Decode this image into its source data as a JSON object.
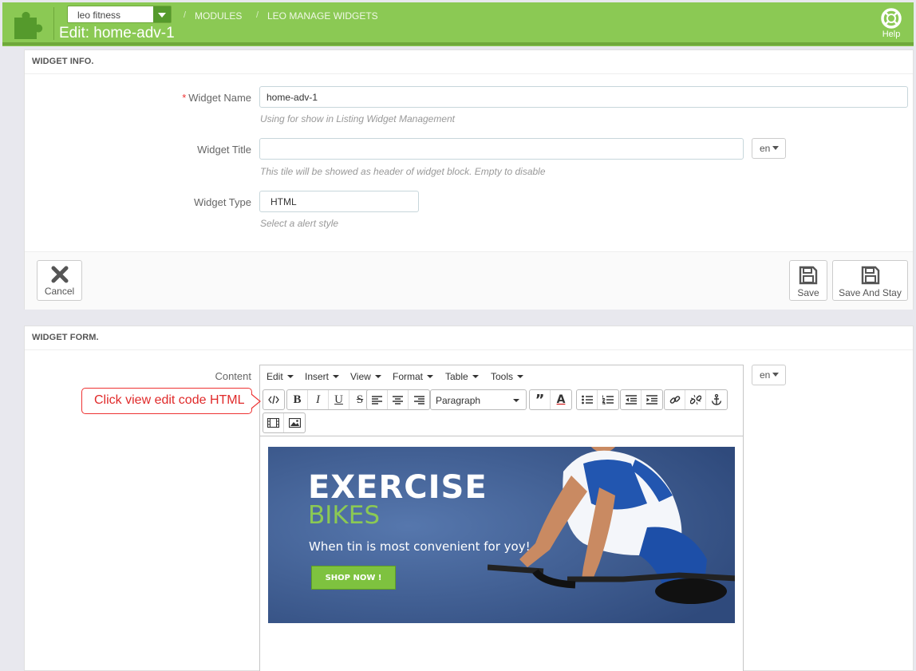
{
  "header": {
    "shop_selector": "leo fitness",
    "breadcrumbs": [
      "MODULES",
      "LEO MANAGE WIDGETS"
    ],
    "title": "Edit: home-adv-1",
    "help_label": "Help",
    "colors": {
      "header": "#8bc954",
      "accent_dark": "#559a2c"
    }
  },
  "widget_info": {
    "heading": "WIDGET INFO.",
    "name_label": "Widget Name",
    "name_value": "home-adv-1",
    "name_help": "Using for show in Listing Widget Management",
    "title_label": "Widget Title",
    "title_value": "",
    "title_help": "This tile will be showed as header of widget block. Empty to disable",
    "title_lang": "en",
    "type_label": "Widget Type",
    "type_value": "HTML",
    "type_help": "Select a alert style",
    "cancel_label": "Cancel",
    "save_label": "Save",
    "save_stay_label": "Save And Stay"
  },
  "widget_form": {
    "heading": "WIDGET FORM.",
    "content_label": "Content",
    "content_lang": "en",
    "menus": [
      "Edit",
      "Insert",
      "View",
      "Format",
      "Table",
      "Tools"
    ],
    "block_format": "Paragraph",
    "toolbar_icons": [
      "code-icon",
      "bold-icon",
      "italic-icon",
      "underline-icon",
      "strikethrough-icon",
      "align-left-icon",
      "align-center-icon",
      "align-right-icon",
      "blockquote-icon",
      "text-color-icon",
      "bullet-list-icon",
      "numbered-list-icon",
      "outdent-icon",
      "indent-icon",
      "link-icon",
      "unlink-icon",
      "anchor-icon",
      "media-icon",
      "image-icon"
    ]
  },
  "banner": {
    "title": "EXERCISE",
    "subtitle": "BIKES",
    "tagline": "When tin is most convenient for yoy!",
    "button": "SHOP NOW !"
  },
  "annotation": {
    "text": "Click view edit code HTML"
  }
}
